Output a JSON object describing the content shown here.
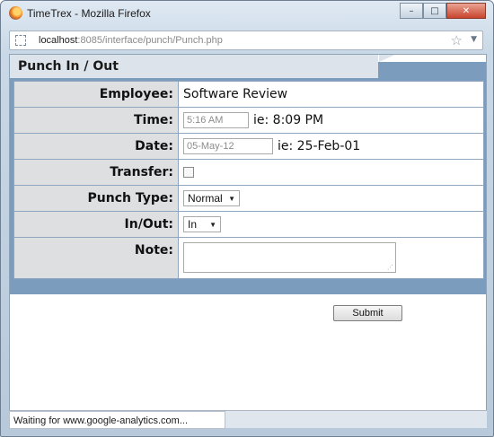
{
  "window": {
    "title": "TimeTrex - Mozilla Firefox",
    "buttons": {
      "minimize": "–",
      "maximize": "□",
      "close": "✕"
    }
  },
  "address": {
    "host": "localhost",
    "rest": ":8085/interface/punch/Punch.php"
  },
  "form": {
    "title": "Punch In / Out",
    "employee": {
      "label": "Employee:",
      "value": "Software Review"
    },
    "time": {
      "label": "Time:",
      "placeholder": "5:16 AM",
      "example": "ie: 8:09 PM"
    },
    "date": {
      "label": "Date:",
      "placeholder": "05-May-12",
      "example": "ie: 25-Feb-01"
    },
    "transfer": {
      "label": "Transfer:",
      "checked": false
    },
    "punch_type": {
      "label": "Punch Type:",
      "selected": "Normal"
    },
    "in_out": {
      "label": "In/Out:",
      "selected": "In"
    },
    "note": {
      "label": "Note:",
      "value": ""
    },
    "submit_label": "Submit"
  },
  "status": {
    "text": "Waiting for www.google-analytics.com..."
  },
  "colors": {
    "header_band": "#7b9cbd",
    "label_bg": "#dedfe1"
  },
  "icons": [
    "firefox-icon",
    "page-icon",
    "star-icon",
    "dropdown-icon",
    "checkbox",
    "resize-grip-icon"
  ]
}
